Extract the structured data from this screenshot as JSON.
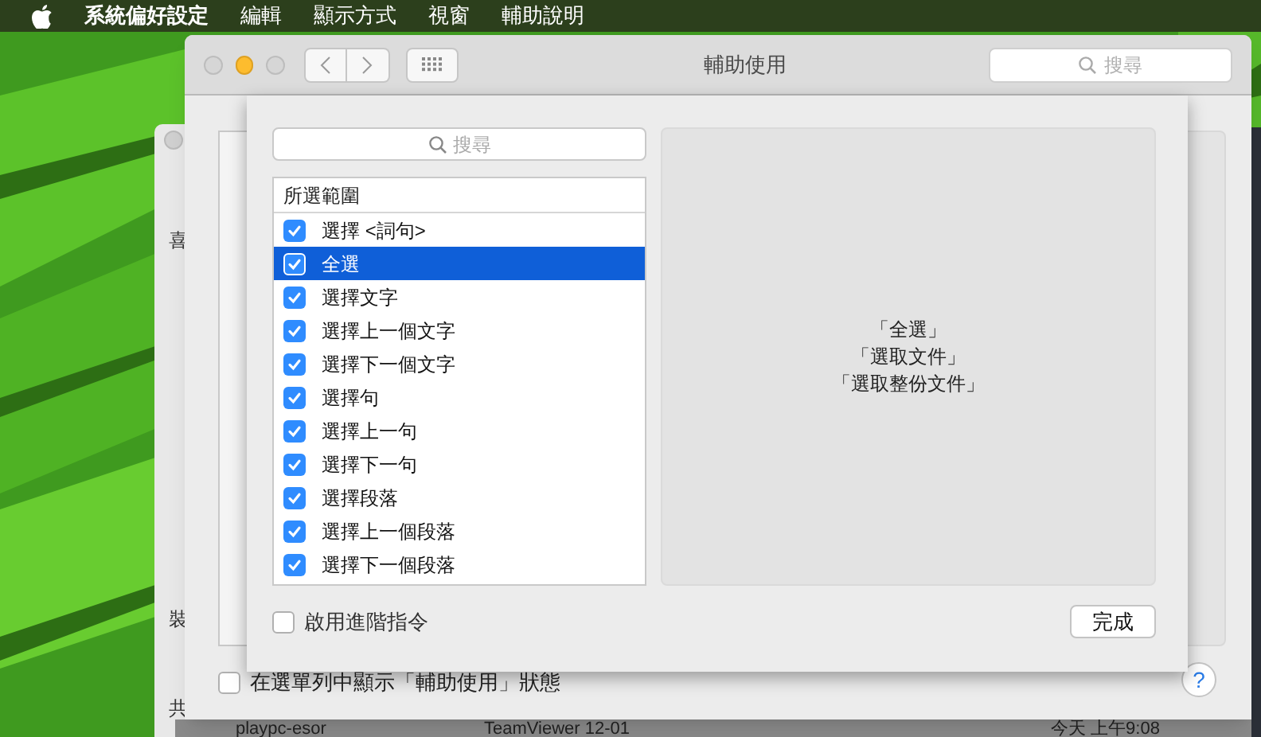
{
  "menu_bar": {
    "items": [
      {
        "label": "系統偏好設定",
        "bold": true
      },
      {
        "label": "編輯",
        "bold": false
      },
      {
        "label": "顯示方式",
        "bold": false
      },
      {
        "label": "視窗",
        "bold": false
      },
      {
        "label": "輔助說明",
        "bold": false
      }
    ]
  },
  "back_window": {
    "labels": [
      "喜",
      "裝",
      "共"
    ],
    "row": [
      "playpc-esor",
      "TeamViewer 12-01",
      "今天 上午9:08"
    ]
  },
  "window": {
    "title": "輔助使用",
    "search": {
      "placeholder": "搜尋"
    },
    "help_button": "?",
    "show_in_menu_bar": {
      "label": "在選單列中顯示「輔助使用」狀態",
      "checked": false
    }
  },
  "sheet": {
    "search": {
      "placeholder": "搜尋"
    },
    "list": {
      "header": "所選範圍",
      "rows": [
        {
          "label": "選擇 <詞句>",
          "checked": true,
          "selected": false
        },
        {
          "label": "全選",
          "checked": true,
          "selected": true
        },
        {
          "label": "選擇文字",
          "checked": true,
          "selected": false
        },
        {
          "label": "選擇上一個文字",
          "checked": true,
          "selected": false
        },
        {
          "label": "選擇下一個文字",
          "checked": true,
          "selected": false
        },
        {
          "label": "選擇句",
          "checked": true,
          "selected": false
        },
        {
          "label": "選擇上一句",
          "checked": true,
          "selected": false
        },
        {
          "label": "選擇下一句",
          "checked": true,
          "selected": false
        },
        {
          "label": "選擇段落",
          "checked": true,
          "selected": false
        },
        {
          "label": "選擇上一個段落",
          "checked": true,
          "selected": false
        },
        {
          "label": "選擇下一個段落",
          "checked": true,
          "selected": false
        }
      ]
    },
    "phrases": [
      "「全選」",
      "「選取文件」",
      "「選取整份文件」"
    ],
    "advanced": {
      "label": "啟用進階指令",
      "checked": false
    },
    "done_button": "完成"
  }
}
